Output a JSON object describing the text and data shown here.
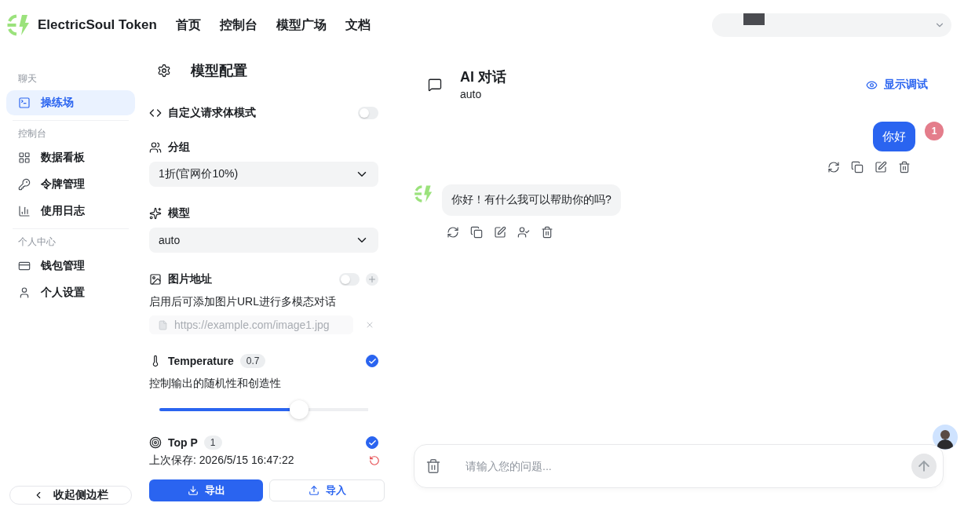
{
  "header": {
    "brand": "ElectricSoul Token",
    "nav": [
      {
        "label": "首页"
      },
      {
        "label": "控制台"
      },
      {
        "label": "模型广场"
      },
      {
        "label": "文档"
      }
    ]
  },
  "sidebar": {
    "sections": [
      {
        "label": "聊天",
        "items": [
          {
            "label": "操练场",
            "selected": true
          }
        ]
      },
      {
        "label": "控制台",
        "items": [
          {
            "label": "数据看板",
            "selected": false
          },
          {
            "label": "令牌管理",
            "selected": false
          },
          {
            "label": "使用日志",
            "selected": false
          }
        ]
      },
      {
        "label": "个人中心",
        "items": [
          {
            "label": "钱包管理",
            "selected": false
          },
          {
            "label": "个人设置",
            "selected": false
          }
        ]
      }
    ],
    "collapse_button": "收起侧边栏"
  },
  "config": {
    "title": "模型配置",
    "custom_body": {
      "label": "自定义请求体模式",
      "on": false
    },
    "group": {
      "label": "分组",
      "value": "1折(官网价10%)"
    },
    "model": {
      "label": "模型",
      "value": "auto"
    },
    "image_url": {
      "label": "图片地址",
      "on": false,
      "description": "启用后可添加图片URL进行多模态对话",
      "placeholder": "https://example.com/image1.jpg",
      "disabled": true
    },
    "params": [
      {
        "label": "Temperature",
        "value": "0.7",
        "checked": true,
        "description": "控制输出的随机性和创造性",
        "level": 0.67
      },
      {
        "label": "Top P",
        "value": "1",
        "checked": true
      }
    ],
    "footer": {
      "saved": "上次保存: 2026/5/15 16:47:22",
      "export_button": "导出",
      "import_button": "导入"
    }
  },
  "chat": {
    "title": "AI 对话",
    "subtitle": "auto",
    "debug_button": "显示调试",
    "messages": [
      {
        "kind": "user",
        "text": "你好",
        "avatar": "1"
      },
      {
        "kind": "assistant",
        "text": "你好！有什么我可以帮助你的吗?"
      }
    ],
    "input": {
      "placeholder": "请输入您的问题..."
    }
  }
}
